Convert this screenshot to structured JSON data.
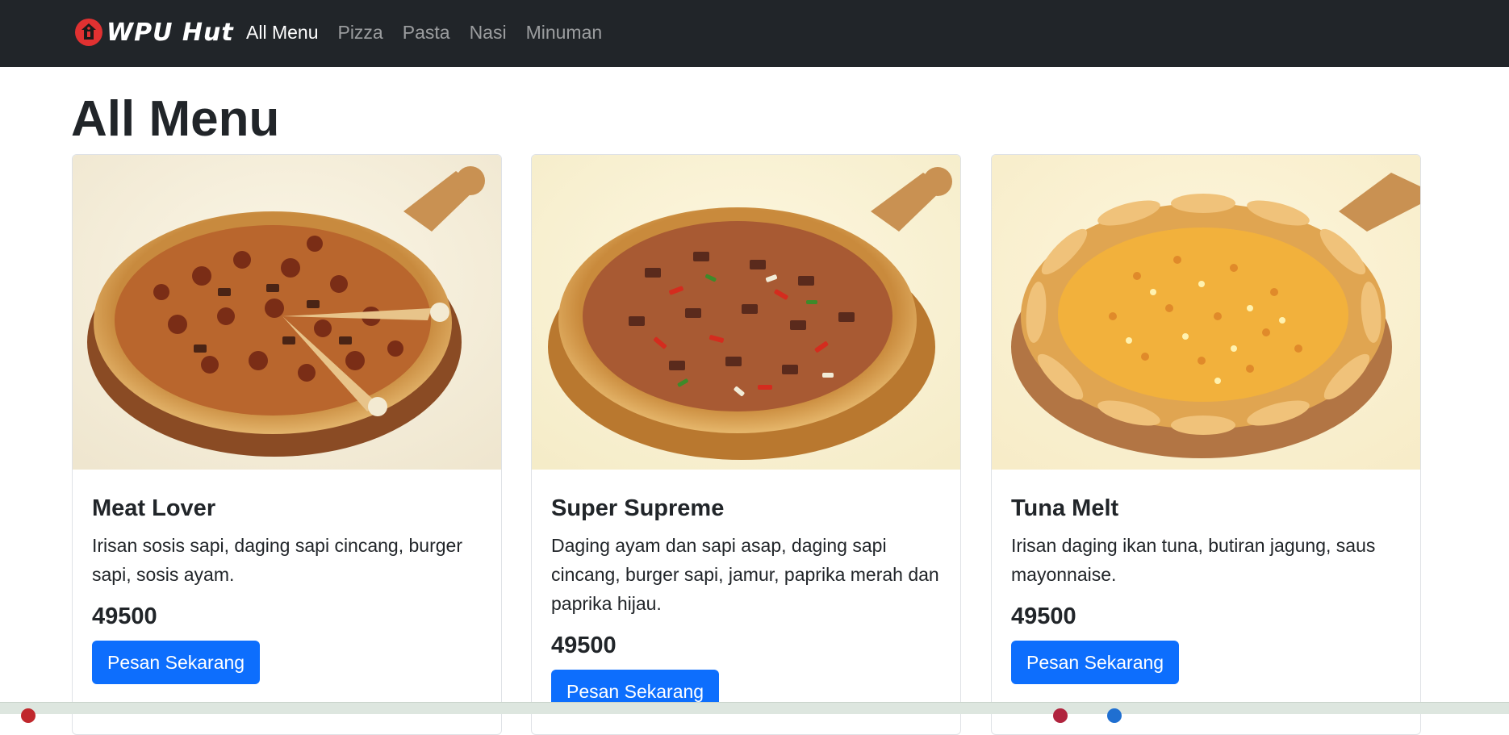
{
  "brand": {
    "name": "WPU Hut"
  },
  "nav": {
    "items": [
      {
        "label": "All Menu",
        "active": true
      },
      {
        "label": "Pizza",
        "active": false
      },
      {
        "label": "Pasta",
        "active": false
      },
      {
        "label": "Nasi",
        "active": false
      },
      {
        "label": "Minuman",
        "active": false
      }
    ]
  },
  "page": {
    "title": "All Menu"
  },
  "menu": [
    {
      "name": "Meat Lover",
      "description": "Irisan sosis sapi, daging sapi cincang, burger sapi, sosis ayam.",
      "price": "49500",
      "button_label": "Pesan Sekarang",
      "image": "pizza-meat-lover"
    },
    {
      "name": "Super Supreme",
      "description": "Daging ayam dan sapi asap, daging sapi cincang, burger sapi, jamur, paprika merah dan paprika hijau.",
      "price": "49500",
      "button_label": "Pesan Sekarang",
      "image": "pizza-super-supreme"
    },
    {
      "name": "Tuna Melt",
      "description": "Irisan daging ikan tuna, butiran jagung, saus mayonnaise.",
      "price": "49500",
      "button_label": "Pesan Sekarang",
      "image": "pizza-tuna-melt"
    }
  ],
  "colors": {
    "navbar": "#212529",
    "primary": "#0d6efd",
    "logo": "#e03131"
  }
}
